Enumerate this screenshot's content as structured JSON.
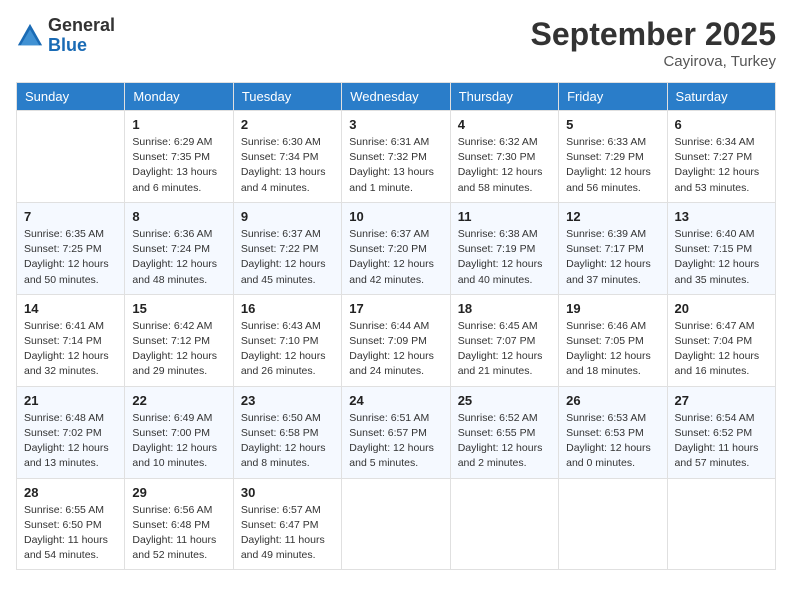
{
  "header": {
    "logo": {
      "general": "General",
      "blue": "Blue"
    },
    "title": "September 2025",
    "location": "Cayirova, Turkey"
  },
  "calendar": {
    "days_of_week": [
      "Sunday",
      "Monday",
      "Tuesday",
      "Wednesday",
      "Thursday",
      "Friday",
      "Saturday"
    ],
    "weeks": [
      [
        {
          "day": "",
          "info": ""
        },
        {
          "day": "1",
          "info": "Sunrise: 6:29 AM\nSunset: 7:35 PM\nDaylight: 13 hours\nand 6 minutes."
        },
        {
          "day": "2",
          "info": "Sunrise: 6:30 AM\nSunset: 7:34 PM\nDaylight: 13 hours\nand 4 minutes."
        },
        {
          "day": "3",
          "info": "Sunrise: 6:31 AM\nSunset: 7:32 PM\nDaylight: 13 hours\nand 1 minute."
        },
        {
          "day": "4",
          "info": "Sunrise: 6:32 AM\nSunset: 7:30 PM\nDaylight: 12 hours\nand 58 minutes."
        },
        {
          "day": "5",
          "info": "Sunrise: 6:33 AM\nSunset: 7:29 PM\nDaylight: 12 hours\nand 56 minutes."
        },
        {
          "day": "6",
          "info": "Sunrise: 6:34 AM\nSunset: 7:27 PM\nDaylight: 12 hours\nand 53 minutes."
        }
      ],
      [
        {
          "day": "7",
          "info": "Sunrise: 6:35 AM\nSunset: 7:25 PM\nDaylight: 12 hours\nand 50 minutes."
        },
        {
          "day": "8",
          "info": "Sunrise: 6:36 AM\nSunset: 7:24 PM\nDaylight: 12 hours\nand 48 minutes."
        },
        {
          "day": "9",
          "info": "Sunrise: 6:37 AM\nSunset: 7:22 PM\nDaylight: 12 hours\nand 45 minutes."
        },
        {
          "day": "10",
          "info": "Sunrise: 6:37 AM\nSunset: 7:20 PM\nDaylight: 12 hours\nand 42 minutes."
        },
        {
          "day": "11",
          "info": "Sunrise: 6:38 AM\nSunset: 7:19 PM\nDaylight: 12 hours\nand 40 minutes."
        },
        {
          "day": "12",
          "info": "Sunrise: 6:39 AM\nSunset: 7:17 PM\nDaylight: 12 hours\nand 37 minutes."
        },
        {
          "day": "13",
          "info": "Sunrise: 6:40 AM\nSunset: 7:15 PM\nDaylight: 12 hours\nand 35 minutes."
        }
      ],
      [
        {
          "day": "14",
          "info": "Sunrise: 6:41 AM\nSunset: 7:14 PM\nDaylight: 12 hours\nand 32 minutes."
        },
        {
          "day": "15",
          "info": "Sunrise: 6:42 AM\nSunset: 7:12 PM\nDaylight: 12 hours\nand 29 minutes."
        },
        {
          "day": "16",
          "info": "Sunrise: 6:43 AM\nSunset: 7:10 PM\nDaylight: 12 hours\nand 26 minutes."
        },
        {
          "day": "17",
          "info": "Sunrise: 6:44 AM\nSunset: 7:09 PM\nDaylight: 12 hours\nand 24 minutes."
        },
        {
          "day": "18",
          "info": "Sunrise: 6:45 AM\nSunset: 7:07 PM\nDaylight: 12 hours\nand 21 minutes."
        },
        {
          "day": "19",
          "info": "Sunrise: 6:46 AM\nSunset: 7:05 PM\nDaylight: 12 hours\nand 18 minutes."
        },
        {
          "day": "20",
          "info": "Sunrise: 6:47 AM\nSunset: 7:04 PM\nDaylight: 12 hours\nand 16 minutes."
        }
      ],
      [
        {
          "day": "21",
          "info": "Sunrise: 6:48 AM\nSunset: 7:02 PM\nDaylight: 12 hours\nand 13 minutes."
        },
        {
          "day": "22",
          "info": "Sunrise: 6:49 AM\nSunset: 7:00 PM\nDaylight: 12 hours\nand 10 minutes."
        },
        {
          "day": "23",
          "info": "Sunrise: 6:50 AM\nSunset: 6:58 PM\nDaylight: 12 hours\nand 8 minutes."
        },
        {
          "day": "24",
          "info": "Sunrise: 6:51 AM\nSunset: 6:57 PM\nDaylight: 12 hours\nand 5 minutes."
        },
        {
          "day": "25",
          "info": "Sunrise: 6:52 AM\nSunset: 6:55 PM\nDaylight: 12 hours\nand 2 minutes."
        },
        {
          "day": "26",
          "info": "Sunrise: 6:53 AM\nSunset: 6:53 PM\nDaylight: 12 hours\nand 0 minutes."
        },
        {
          "day": "27",
          "info": "Sunrise: 6:54 AM\nSunset: 6:52 PM\nDaylight: 11 hours\nand 57 minutes."
        }
      ],
      [
        {
          "day": "28",
          "info": "Sunrise: 6:55 AM\nSunset: 6:50 PM\nDaylight: 11 hours\nand 54 minutes."
        },
        {
          "day": "29",
          "info": "Sunrise: 6:56 AM\nSunset: 6:48 PM\nDaylight: 11 hours\nand 52 minutes."
        },
        {
          "day": "30",
          "info": "Sunrise: 6:57 AM\nSunset: 6:47 PM\nDaylight: 11 hours\nand 49 minutes."
        },
        {
          "day": "",
          "info": ""
        },
        {
          "day": "",
          "info": ""
        },
        {
          "day": "",
          "info": ""
        },
        {
          "day": "",
          "info": ""
        }
      ]
    ]
  }
}
